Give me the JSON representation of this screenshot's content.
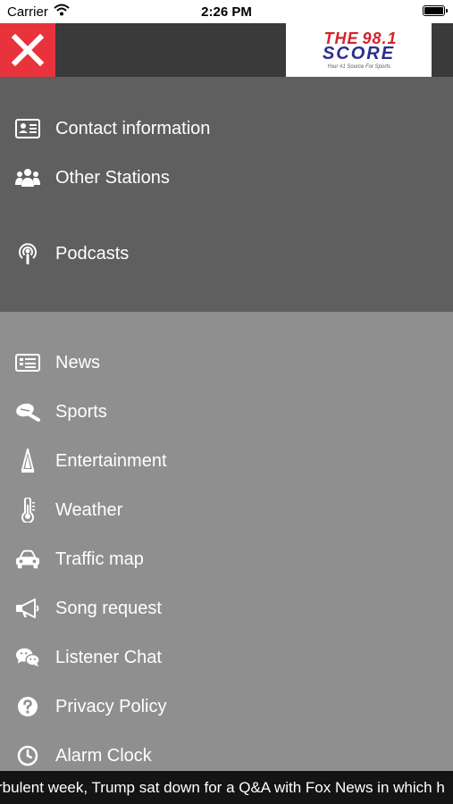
{
  "status_bar": {
    "carrier": "Carrier",
    "time": "2:26 PM"
  },
  "logo": {
    "line1": "THE",
    "line1_number": "98.1",
    "line2": "SCORE",
    "tagline": "Your #1 Source For Sports"
  },
  "top_menu": [
    {
      "label": "Contact information",
      "icon": "contact-card-icon"
    },
    {
      "label": "Other Stations",
      "icon": "users-group-icon"
    },
    {
      "label": "Podcasts",
      "icon": "podcast-icon"
    }
  ],
  "menu": [
    {
      "label": "News",
      "icon": "newspaper-icon"
    },
    {
      "label": "Sports",
      "icon": "sports-ball-icon"
    },
    {
      "label": "Entertainment",
      "icon": "entertainment-icon"
    },
    {
      "label": "Weather",
      "icon": "thermometer-icon"
    },
    {
      "label": "Traffic map",
      "icon": "car-icon"
    },
    {
      "label": "Song request",
      "icon": "megaphone-icon"
    },
    {
      "label": "Listener Chat",
      "icon": "chat-bubbles-icon"
    },
    {
      "label": "Privacy Policy",
      "icon": "question-circle-icon"
    },
    {
      "label": "Alarm Clock",
      "icon": "clock-icon"
    }
  ],
  "ticker": {
    "text": "rbulent week, Trump sat down for a Q&A with Fox News in which h"
  },
  "colors": {
    "close_bg": "#e8333c",
    "topbar_bg": "#3a3a3a",
    "top_section_bg": "#5f5f5f",
    "menu_bg": "#8f8f8f",
    "ticker_bg": "#141414"
  }
}
